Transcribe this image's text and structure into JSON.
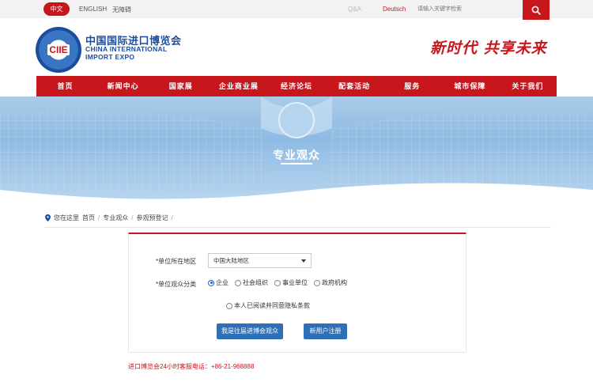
{
  "topbar": {
    "lang_zh": "中文",
    "lang_en": "ENGLISH",
    "accessibility": "无障碍",
    "qa": "Q&A",
    "deutsch": "Deutsch",
    "search_placeholder": "请输入关键字检索"
  },
  "header": {
    "logo_mark": "CIIE",
    "name_cn": "中国国际进口博览会",
    "name_en_line1": "CHINA INTERNATIONAL",
    "name_en_line2": "IMPORT EXPO",
    "slogan": "新时代 共享未来"
  },
  "nav": {
    "items": [
      "首页",
      "新闻中心",
      "国家展",
      "企业商业展",
      "经济论坛",
      "配套活动",
      "服务",
      "城市保障",
      "关于我们"
    ]
  },
  "banner": {
    "title": "专业观众"
  },
  "breadcrumb": {
    "prefix": "您在这里",
    "items": [
      "首页",
      "专业观众",
      "参观预登记"
    ]
  },
  "form": {
    "region_label": "*单位所在地区",
    "region_value": "中国大陆地区",
    "category_label": "*单位观众分类",
    "category_options": [
      "企业",
      "社会组织",
      "事业单位",
      "政府机构"
    ],
    "category_selected": "企业",
    "agree_text": "本人已阅读并同意隐私条款",
    "btn_returning": "我是往届进博会观众",
    "btn_register": "新用户注册"
  },
  "footer": {
    "hotline": "进口博览会24小时客服电话：+86-21-968888"
  },
  "colors": {
    "brand_red": "#c8161d",
    "brand_blue": "#1a4d9e",
    "button_blue": "#2f6fb8"
  }
}
